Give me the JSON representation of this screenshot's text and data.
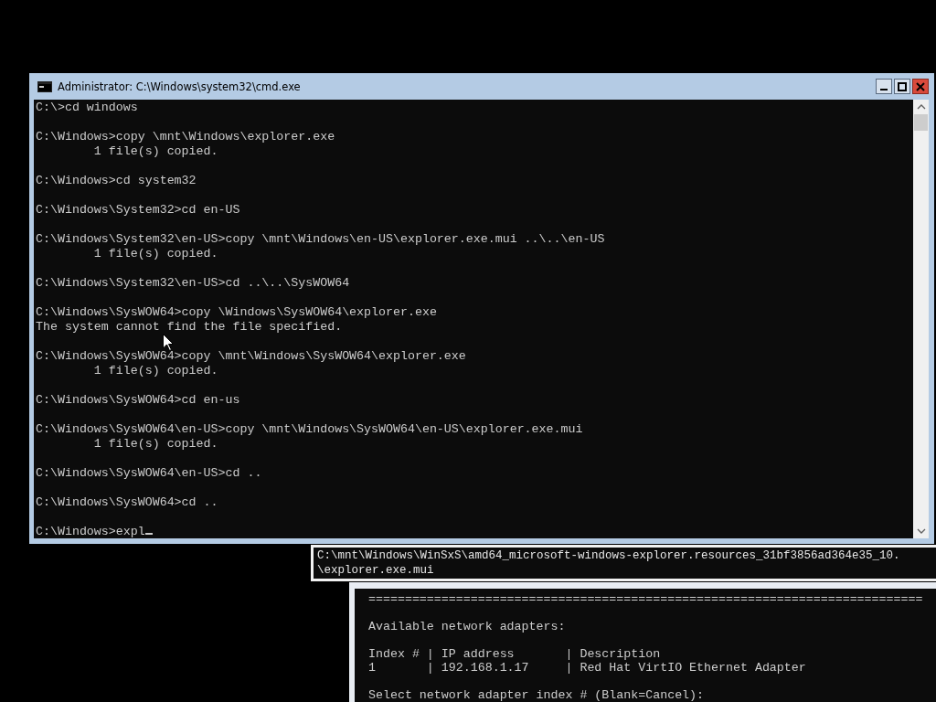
{
  "main_window": {
    "title": "Administrator: C:\\Windows\\system32\\cmd.exe",
    "blocks": [
      [
        "C:\\>cd windows"
      ],
      [
        "C:\\Windows>copy \\mnt\\Windows\\explorer.exe",
        "        1 file(s) copied."
      ],
      [
        "C:\\Windows>cd system32"
      ],
      [
        "C:\\Windows\\System32>cd en-US"
      ],
      [
        "C:\\Windows\\System32\\en-US>copy \\mnt\\Windows\\en-US\\explorer.exe.mui ..\\..\\en-US",
        "        1 file(s) copied."
      ],
      [
        "C:\\Windows\\System32\\en-US>cd ..\\..\\SysWOW64"
      ],
      [
        "C:\\Windows\\SysWOW64>copy \\Windows\\SysWOW64\\explorer.exe",
        "The system cannot find the file specified."
      ],
      [
        "C:\\Windows\\SysWOW64>copy \\mnt\\Windows\\SysWOW64\\explorer.exe",
        "        1 file(s) copied."
      ],
      [
        "C:\\Windows\\SysWOW64>cd en-us"
      ],
      [
        "C:\\Windows\\SysWOW64\\en-US>copy \\mnt\\Windows\\SysWOW64\\en-US\\explorer.exe.mui",
        "        1 file(s) copied."
      ],
      [
        "C:\\Windows\\SysWOW64\\en-US>cd .."
      ],
      [
        "C:\\Windows\\SysWOW64>cd .."
      ]
    ],
    "input_line": "C:\\Windows>expl"
  },
  "completion_popup": {
    "lines": [
      "C:\\mnt\\Windows\\WinSxS\\amd64_microsoft-windows-explorer.resources_31bf3856ad364e35_10.",
      "\\explorer.exe.mui"
    ]
  },
  "back_window": {
    "blocks": [
      [
        "============================================================================"
      ],
      [
        "Available network adapters:"
      ],
      [
        "Index # | IP address       | Description",
        "1       | 192.168.1.17     | Red Hat VirtIO Ethernet Adapter"
      ],
      [
        "Select network adapter index # (Blank=Cancel):"
      ]
    ]
  }
}
